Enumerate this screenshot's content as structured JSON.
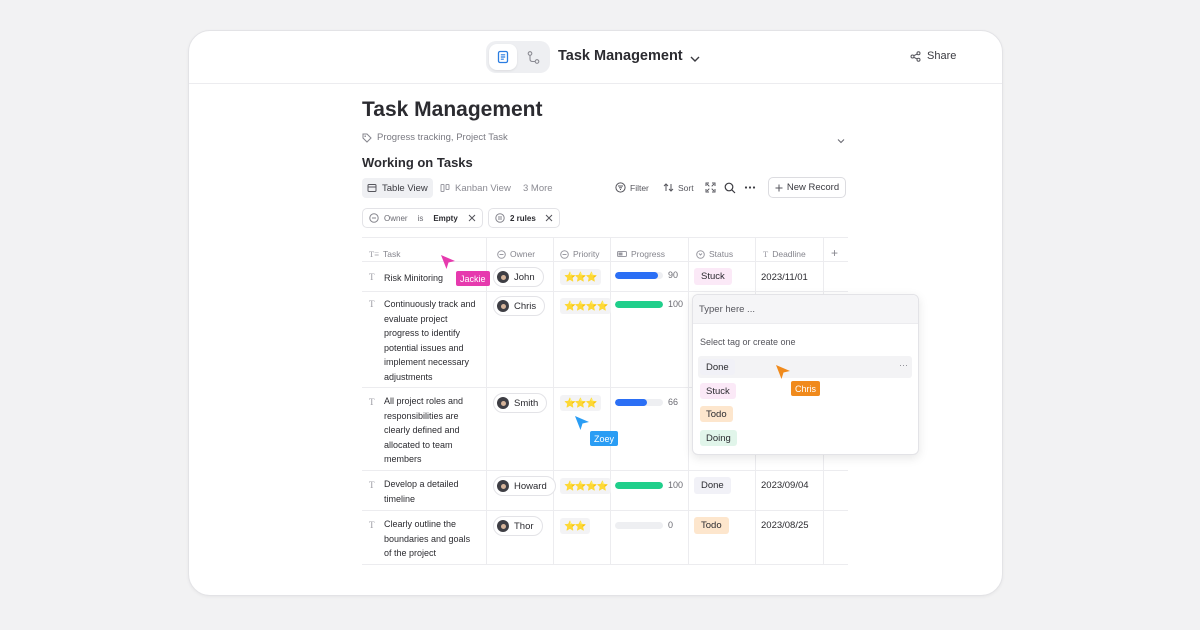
{
  "window": {
    "title": "Task Management",
    "share_label": "Share"
  },
  "doc": {
    "title": "Task Management",
    "tags_text": "Progress tracking, Project Task",
    "section_title": "Working on Tasks"
  },
  "views": {
    "table": "Table View",
    "kanban": "Kanban View",
    "more": "3 More"
  },
  "toolbar": {
    "filter": "Filter",
    "sort": "Sort",
    "new_record": "New Record"
  },
  "filters": {
    "owner_field": "Owner",
    "owner_op": "is",
    "owner_value": "Empty",
    "rules": "2 rules"
  },
  "columns": {
    "task": "Task",
    "owner": "Owner",
    "priority": "Priority",
    "progress": "Progress",
    "status": "Status",
    "deadline": "Deadline"
  },
  "rows": [
    {
      "task": "Risk Minitoring",
      "owner": "John",
      "stars": "⭐⭐⭐",
      "progress": 90,
      "progress_label": "90",
      "status": "Stuck",
      "deadline": "2023/11/01"
    },
    {
      "task": "Continuously track and evaluate project progress to identify potential issues and implement necessary adjustments",
      "owner": "Chris",
      "stars": "⭐⭐⭐⭐",
      "progress": 100,
      "progress_label": "100",
      "status": "",
      "deadline": ""
    },
    {
      "task": "All project roles and responsibilities are clearly defined and allocated to team members",
      "owner": "Smith",
      "stars": "⭐⭐⭐",
      "progress": 66,
      "progress_label": "66",
      "status": "",
      "deadline": ""
    },
    {
      "task": "Develop a detailed timeline",
      "owner": "Howard",
      "stars": "⭐⭐⭐⭐",
      "progress": 100,
      "progress_label": "100",
      "status": "Done",
      "deadline": "2023/09/04"
    },
    {
      "task": "Clearly outline the boundaries and goals of the project",
      "owner": "Thor",
      "stars": "⭐⭐",
      "progress": 0,
      "progress_label": "0",
      "status": "Todo",
      "deadline": "2023/08/25"
    }
  ],
  "status_dropdown": {
    "placeholder": "Typer here ...",
    "help": "Select tag or create one",
    "options": [
      "Done",
      "Stuck",
      "Todo",
      "Doing"
    ],
    "more": "···"
  },
  "cursors": {
    "jackie": "Jackie",
    "zoey": "Zoey",
    "chris": "Chris"
  },
  "colors": {
    "progress_blue": "#2b6ff5",
    "progress_green": "#1fcf8b",
    "stuck_bg": "#fbe9f7",
    "done_bg": "#f1f1f7",
    "todo_bg": "#fde6cd",
    "doing_bg": "#e1f5ea",
    "jackie": "#e63aae",
    "zoey": "#2a9df4",
    "chris": "#f08a1c"
  }
}
